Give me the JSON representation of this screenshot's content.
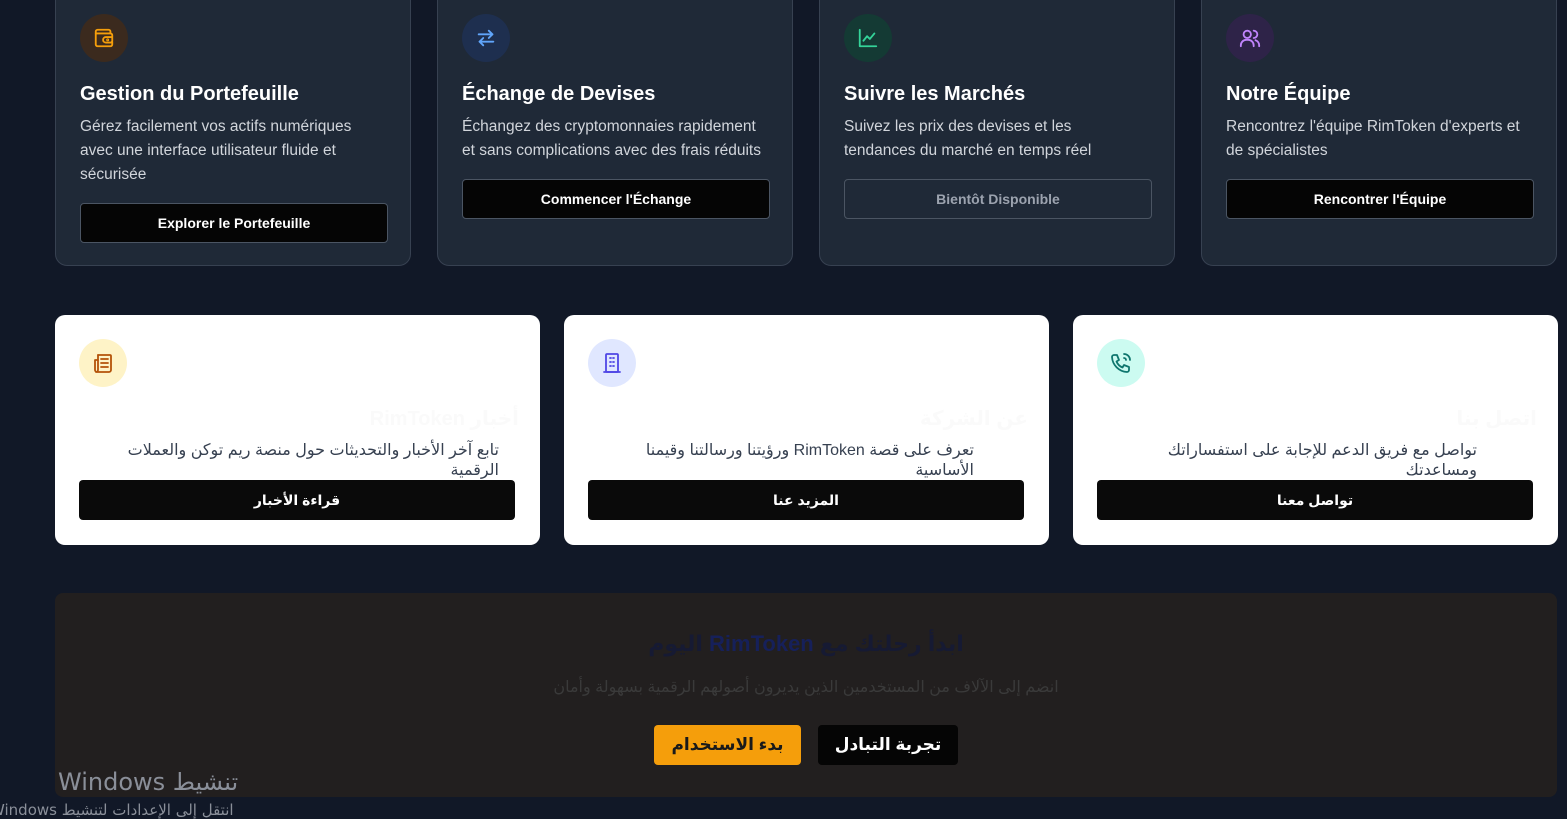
{
  "feature_cards": [
    {
      "title": "Gestion du Portefeuille",
      "description": "Gérez facilement vos actifs numériques avec une interface utilisateur fluide et sécurisée",
      "button": "Explorer le Portefeuille",
      "icon": "wallet-icon",
      "icon_color": "#f59e0b",
      "icon_bg": "#3b2a1e"
    },
    {
      "title": "Échange de Devises",
      "description": "Échangez des cryptomonnaies rapidement et sans complications avec des frais réduits",
      "button": "Commencer l'Échange",
      "icon": "swap-arrows-icon",
      "icon_color": "#60a5fa",
      "icon_bg": "#1e2f4f"
    },
    {
      "title": "Suivre les Marchés",
      "description": "Suivez les prix des devises et les tendances du marché en temps réel",
      "button": "Bientôt Disponible",
      "icon": "line-chart-icon",
      "icon_color": "#34d399",
      "icon_bg": "#143a34"
    },
    {
      "title": "Notre Équipe",
      "description": "Rencontrez l'équipe RimToken d'experts et de spécialistes",
      "button": "Rencontrer l'Équipe",
      "icon": "users-icon",
      "icon_color": "#c084fc",
      "icon_bg": "#2e2348"
    }
  ],
  "info_cards": [
    {
      "title": "أخبار RimToken",
      "description": "تابع آخر الأخبار والتحديثات حول منصة ريم توكن والعملات الرقمية",
      "button": "قراءة الأخبار",
      "icon": "newspaper-icon",
      "icon_color": "#b45309",
      "icon_bg": "#fef3c7"
    },
    {
      "title": "عن الشركة",
      "description": "تعرف على قصة RimToken ورؤيتنا ورسالتنا وقيمنا الأساسية",
      "button": "المزيد عنا",
      "icon": "building-icon",
      "icon_color": "#4f46e5",
      "icon_bg": "#e0e7ff"
    },
    {
      "title": "اتصل بنا",
      "description": "تواصل مع فريق الدعم للإجابة على استفساراتك ومساعدتك",
      "button": "تواصل معنا",
      "icon": "phone-call-icon",
      "icon_color": "#0f766e",
      "icon_bg": "#ccfbf1"
    }
  ],
  "cta": {
    "title_before": "ابدأ رحلتك مع",
    "brand": "RimToken",
    "title_after": "اليوم",
    "subtitle": "انضم إلى الآلاف من المستخدمين الذين يديرون أصولهم الرقمية بسهولة وأمان",
    "primary_button": "بدء الاستخدام",
    "secondary_button": "تجربة التبادل",
    "accent": "#f59e0b"
  },
  "watermark": {
    "line1": "تنشيط Windows",
    "line2": "انتقل إلى الإعدادات لتنشيط Windows"
  }
}
